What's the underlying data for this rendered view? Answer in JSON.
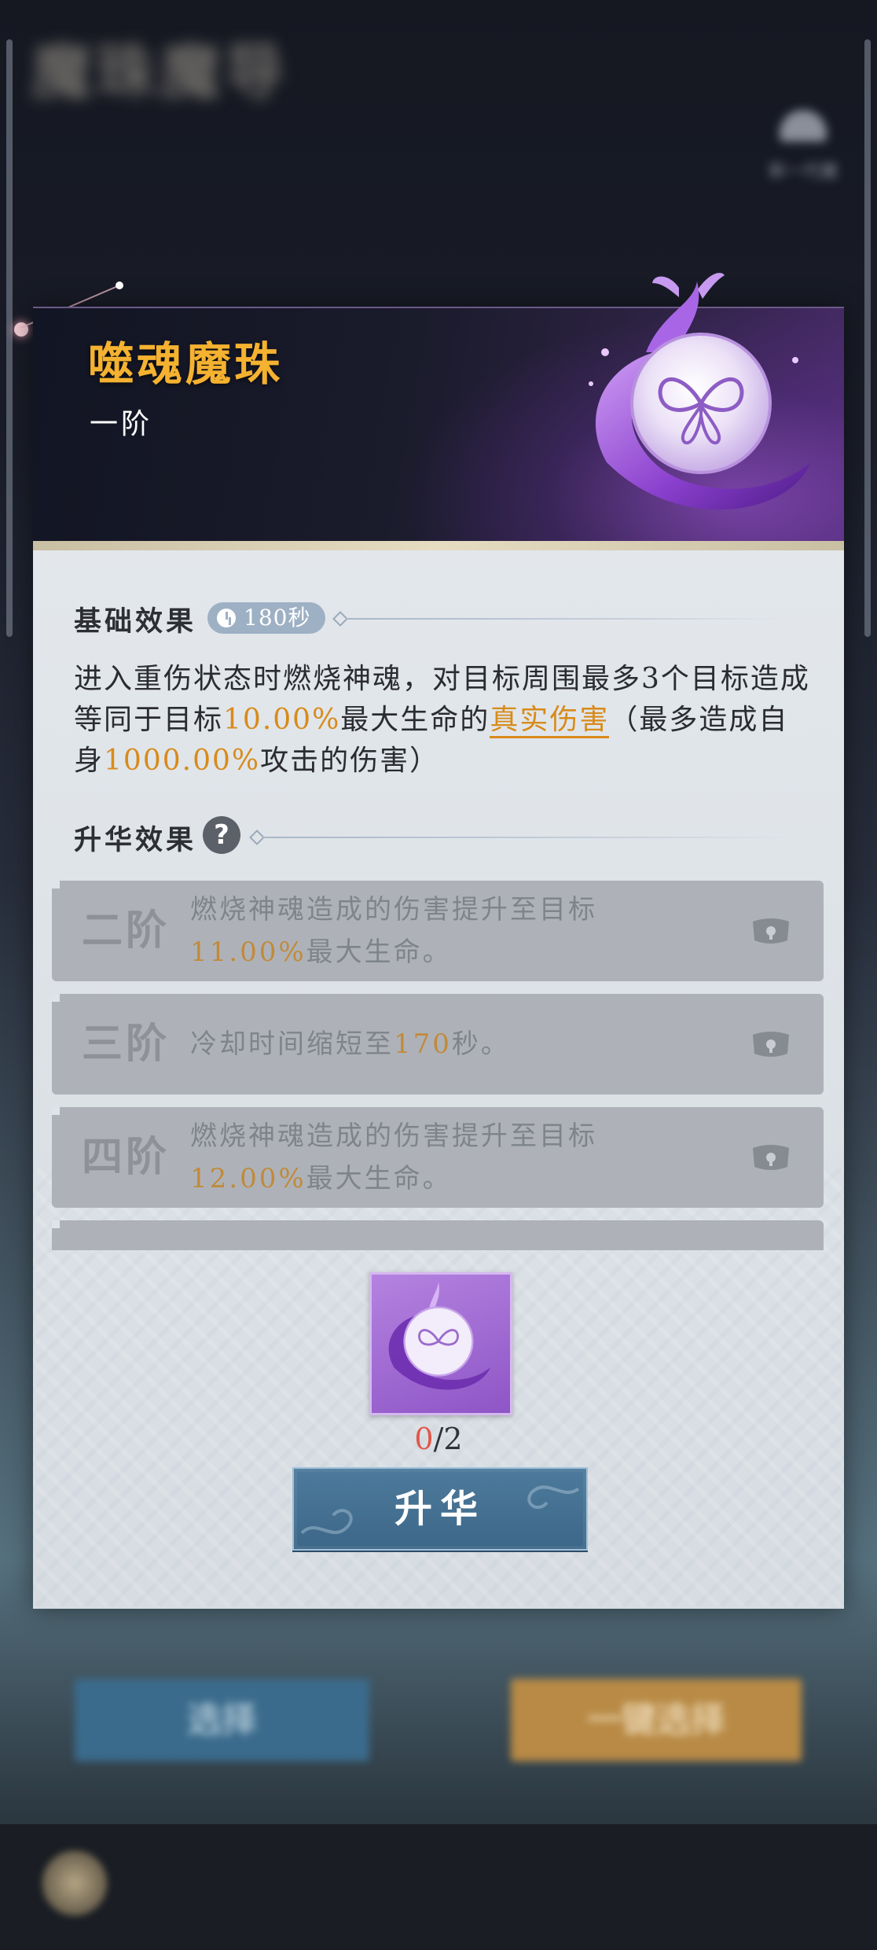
{
  "background": {
    "title": "魔珠魔导",
    "emblem_label": "新一代魔",
    "button_left": "选择",
    "button_right": "一键选择"
  },
  "item": {
    "name": "噬魂魔珠",
    "rank": "一阶"
  },
  "base_effect": {
    "label": "基础效果",
    "cooldown": "180秒",
    "desc_1": "进入重伤状态时燃烧神魂，对目标周围最多3个目标造成等同于目标",
    "value_1": "10.00%",
    "desc_2": "最大生命的",
    "keyword": "真实伤害",
    "desc_3": "（最多造成自身",
    "value_2": "1000.00%",
    "desc_4": "攻击的伤害）"
  },
  "ascend_effect": {
    "label": "升华效果",
    "help_glyph": "?"
  },
  "tiers": [
    {
      "name": "二阶",
      "line1": "燃烧神魂造成的伤害提升至目标",
      "value": "11.00%",
      "tail": "最大生命。",
      "locked": true
    },
    {
      "name": "三阶",
      "line1": "冷却时间缩短至",
      "value": "170",
      "tail": "秒。",
      "locked": true
    },
    {
      "name": "四阶",
      "line1": "燃烧神魂造成的伤害提升至目标",
      "value": "12.00%",
      "tail": "最大生命。",
      "locked": true
    }
  ],
  "material": {
    "current": "0",
    "separator": "/",
    "required": "2"
  },
  "ascend_button": {
    "label": "升华"
  },
  "colors": {
    "title_gold": "#f5b230",
    "highlight_orange": "#d88b1a",
    "button_blue": "#4d7a9c",
    "orb_purple": "#9b5ed6"
  },
  "icons": [
    "clock-icon",
    "help-icon",
    "lock-icon",
    "butterfly-orb-icon"
  ]
}
